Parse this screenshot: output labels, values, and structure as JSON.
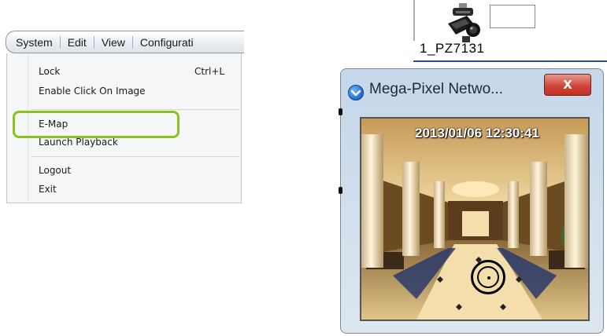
{
  "menubar": {
    "items": [
      "System",
      "Edit",
      "View",
      "Configurati"
    ]
  },
  "system_menu": {
    "items": [
      {
        "label": "Lock",
        "shortcut": "Ctrl+L"
      },
      {
        "label": "Enable Click On Image",
        "shortcut": ""
      },
      {
        "label": "E-Map",
        "shortcut": ""
      },
      {
        "label": "Launch Playback",
        "shortcut": ""
      },
      {
        "label": "Logout",
        "shortcut": ""
      },
      {
        "label": "Exit",
        "shortcut": ""
      }
    ],
    "highlight_color": "#8cc21e"
  },
  "device": {
    "name": "1_PZ7131",
    "icon": "ptz-camera-icon"
  },
  "camera_window": {
    "title": "Mega-Pixel Netwo...",
    "close_label": "X",
    "timestamp": "2013/01/06 12:30:41",
    "title_icon": "app-icon",
    "close_color": "#d0463a"
  }
}
